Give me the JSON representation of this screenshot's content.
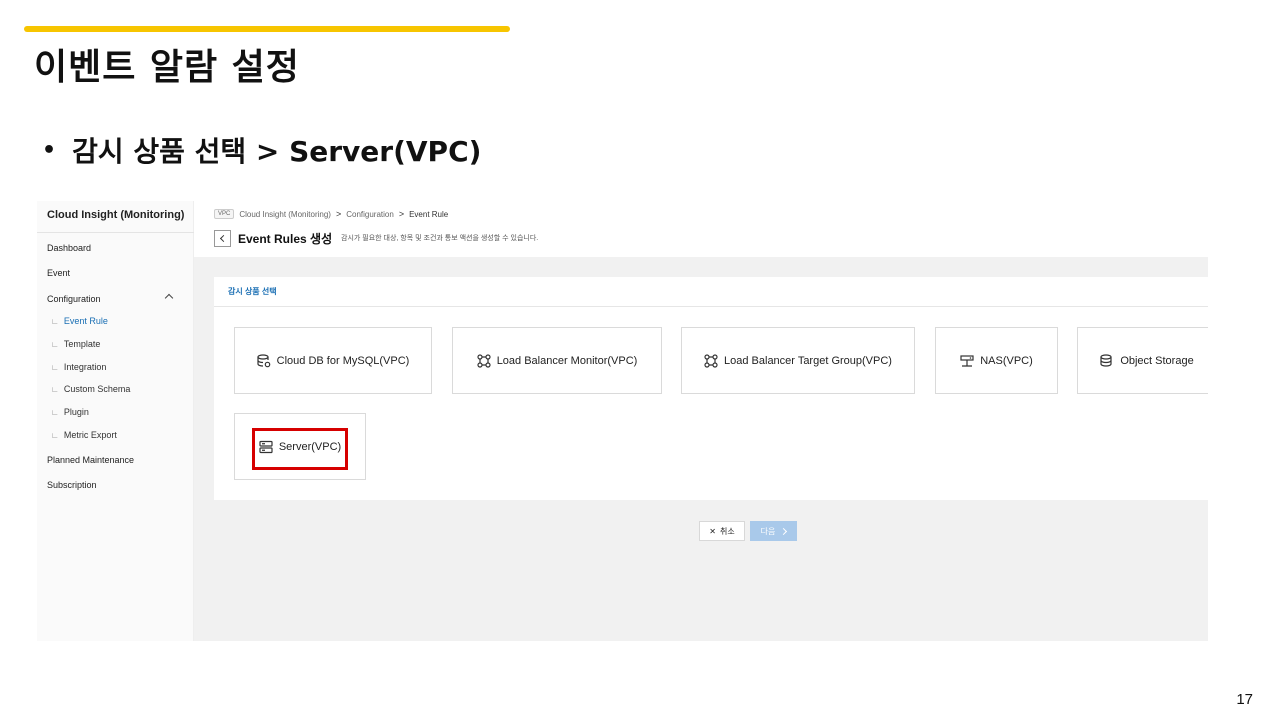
{
  "slide": {
    "title": "이벤트 알람 설정",
    "bullet_symbol": "•",
    "bullet": "감시 상품 선택 > Server(VPC)",
    "page_number": "17",
    "accent_color": "#f7c500"
  },
  "sidebar": {
    "title": "Cloud Insight (Monitoring)",
    "items": [
      {
        "label": "Dashboard"
      },
      {
        "label": "Event"
      },
      {
        "label": "Configuration"
      },
      {
        "label": "Planned Maintenance"
      },
      {
        "label": "Subscription"
      }
    ],
    "sub_items": [
      {
        "label": "Event Rule",
        "active": true
      },
      {
        "label": "Template"
      },
      {
        "label": "Integration"
      },
      {
        "label": "Custom Schema"
      },
      {
        "label": "Plugin"
      },
      {
        "label": "Metric Export"
      }
    ],
    "sub_marker": "∟"
  },
  "header": {
    "vpc_tag": "VPC",
    "breadcrumb": [
      "Cloud Insight (Monitoring)",
      "Configuration",
      "Event Rule"
    ],
    "breadcrumb_sep": ">",
    "title": "Event Rules 생성",
    "description": "감시가 필요한 대상, 항목 및 조건과 통보 액션을 생성할 수 있습니다."
  },
  "panel": {
    "title": "감시 상품 선택",
    "products": [
      {
        "label": "Cloud DB for MySQL(VPC)",
        "icon": "database-settings-icon"
      },
      {
        "label": "Load Balancer Monitor(VPC)",
        "icon": "network-nodes-icon"
      },
      {
        "label": "Load Balancer Target Group(VPC)",
        "icon": "network-nodes-icon"
      },
      {
        "label": "NAS(VPC)",
        "icon": "nas-storage-icon"
      },
      {
        "label": "Object Storage",
        "icon": "object-storage-icon"
      },
      {
        "label": "Server(VPC)",
        "icon": "server-icon",
        "selected": true
      }
    ],
    "highlight_color": "#d60000"
  },
  "actions": {
    "cancel_icon": "✕",
    "cancel_label": "취소",
    "next_label": "다음",
    "next_color": "#a9c9ea"
  }
}
